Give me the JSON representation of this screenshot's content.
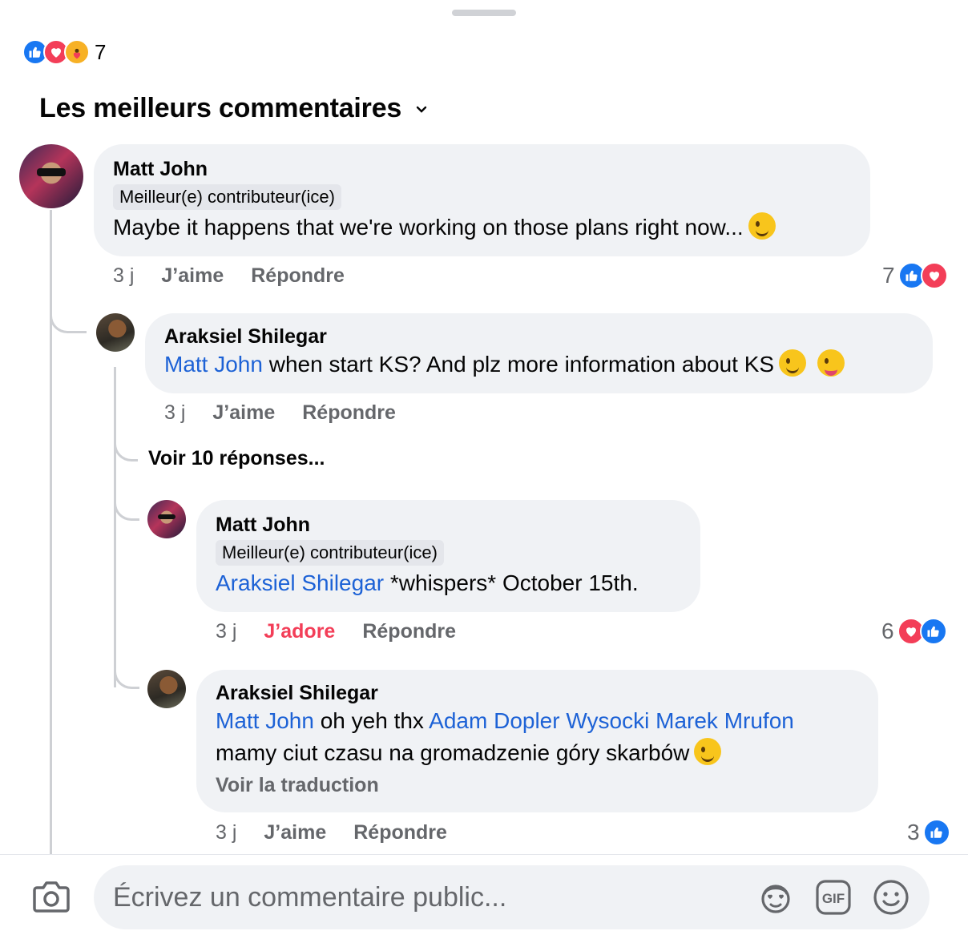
{
  "reactions": {
    "count": "7",
    "icons": [
      "like-icon",
      "love-icon",
      "care-icon"
    ]
  },
  "sort": {
    "label": "Les meilleurs commentaires"
  },
  "comments": [
    {
      "author": "Matt John",
      "badge": "Meilleur(e) contributeur(ice)",
      "text": "Maybe it happens that we're working on those plans right now...",
      "time": "3 j",
      "like": "J’aime",
      "reply": "Répondre",
      "reaction_count": "7"
    },
    {
      "author": "Araksiel Shilegar",
      "mention": "Matt John",
      "text": " when start KS? And plz more information about KS",
      "time": "3 j",
      "like": "J’aime",
      "reply": "Répondre"
    },
    {
      "author": "Matt John",
      "badge": "Meilleur(e) contributeur(ice)",
      "mention": "Araksiel Shilegar",
      "text": " *whispers* October 15th.",
      "time": "3 j",
      "like": "J’adore",
      "reply": "Répondre",
      "reaction_count": "6"
    },
    {
      "author": "Araksiel Shilegar",
      "mention": "Matt John",
      "text1": " oh yeh thx ",
      "mention2": "Adam Dopler Wysocki",
      "mention3": "Marek Mrufon",
      "text2": "mamy ciut czasu na gromadzenie góry skarbów",
      "translate": "Voir la traduction",
      "time": "3 j",
      "like": "J’aime",
      "reply": "Répondre",
      "reaction_count": "3"
    }
  ],
  "more_replies": "Voir 10 réponses...",
  "composer": {
    "placeholder": "Écrivez un commentaire public..."
  },
  "colors": {
    "accent": "#1877f2",
    "love": "#f33e58",
    "mention": "#1d62d6",
    "bubble": "#f0f2f5",
    "meta": "#65676b"
  }
}
